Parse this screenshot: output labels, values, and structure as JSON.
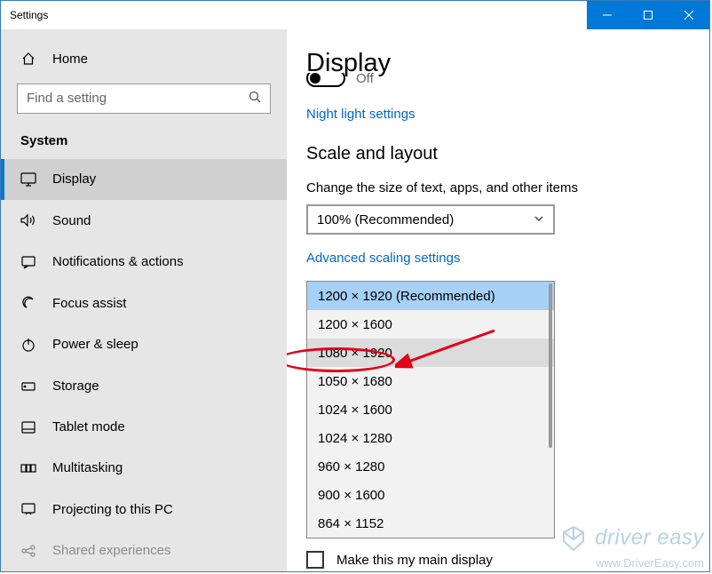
{
  "window": {
    "title": "Settings"
  },
  "sidebar": {
    "home": "Home",
    "search_placeholder": "Find a setting",
    "category": "System",
    "items": [
      {
        "label": "Display",
        "selected": true
      },
      {
        "label": "Sound"
      },
      {
        "label": "Notifications & actions"
      },
      {
        "label": "Focus assist"
      },
      {
        "label": "Power & sleep"
      },
      {
        "label": "Storage"
      },
      {
        "label": "Tablet mode"
      },
      {
        "label": "Multitasking"
      },
      {
        "label": "Projecting to this PC"
      },
      {
        "label": "Shared experiences"
      }
    ]
  },
  "content": {
    "page_title": "Display",
    "toggle_state": "Off",
    "night_light_link": "Night light settings",
    "scale_section": "Scale and layout",
    "scale_label": "Change the size of text, apps, and other items",
    "scale_value": "100% (Recommended)",
    "advanced_scaling_link": "Advanced scaling settings",
    "resolution_options": [
      "1200 × 1920 (Recommended)",
      "1200 × 1600",
      "1080 × 1920",
      "1050 × 1680",
      "1024 × 1600",
      "1024 × 1280",
      "960 × 1280",
      "900 × 1600",
      "864 × 1152"
    ],
    "main_display_label": "Make this my main display"
  },
  "watermark": {
    "line1": "driver easy",
    "line2": "www.DriverEasy.com"
  }
}
